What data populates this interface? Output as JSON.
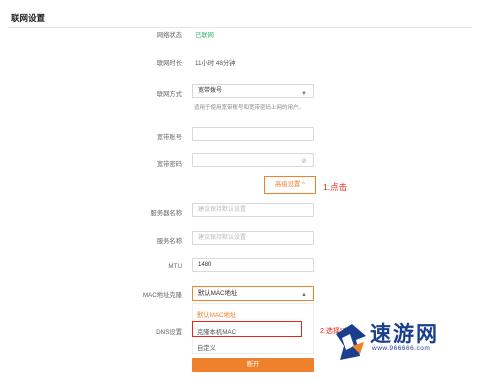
{
  "page_title": "联网设置",
  "status": {
    "label": "网络状态",
    "value": "已联网"
  },
  "duration": {
    "label": "联网时长",
    "value": "11小时 48分钟"
  },
  "mode": {
    "label": "联网方式",
    "value": "宽带拨号",
    "hint": "适用于使用宽带账号和宽带密码上网的用户。"
  },
  "account": {
    "label": "宽带账号",
    "value": ""
  },
  "password": {
    "label": "宽带密码",
    "value": ""
  },
  "advanced": {
    "label": "高级设置 ^",
    "annotation": "1.点击"
  },
  "server_name": {
    "label": "服务器名称",
    "placeholder": "建议保持默认设置"
  },
  "service_name": {
    "label": "服务名称",
    "placeholder": "建议保持默认设置"
  },
  "mtu": {
    "label": "MTU",
    "value": "1480"
  },
  "mac_clone": {
    "label": "MAC地址克隆",
    "value": "默认MAC地址",
    "options": [
      "默认MAC地址",
      "克隆本机MAC",
      "自定义"
    ],
    "annotation": "2.选择“克"
  },
  "dns": {
    "label": "DNS设置"
  },
  "disconnect_label": "断开",
  "watermark": {
    "name": "速游网",
    "url": "www.966666.com"
  },
  "colors": {
    "accent": "#f0812c",
    "annotation": "#e8251a",
    "connected": "#36b56b",
    "watermark": "#1a3f8f"
  }
}
